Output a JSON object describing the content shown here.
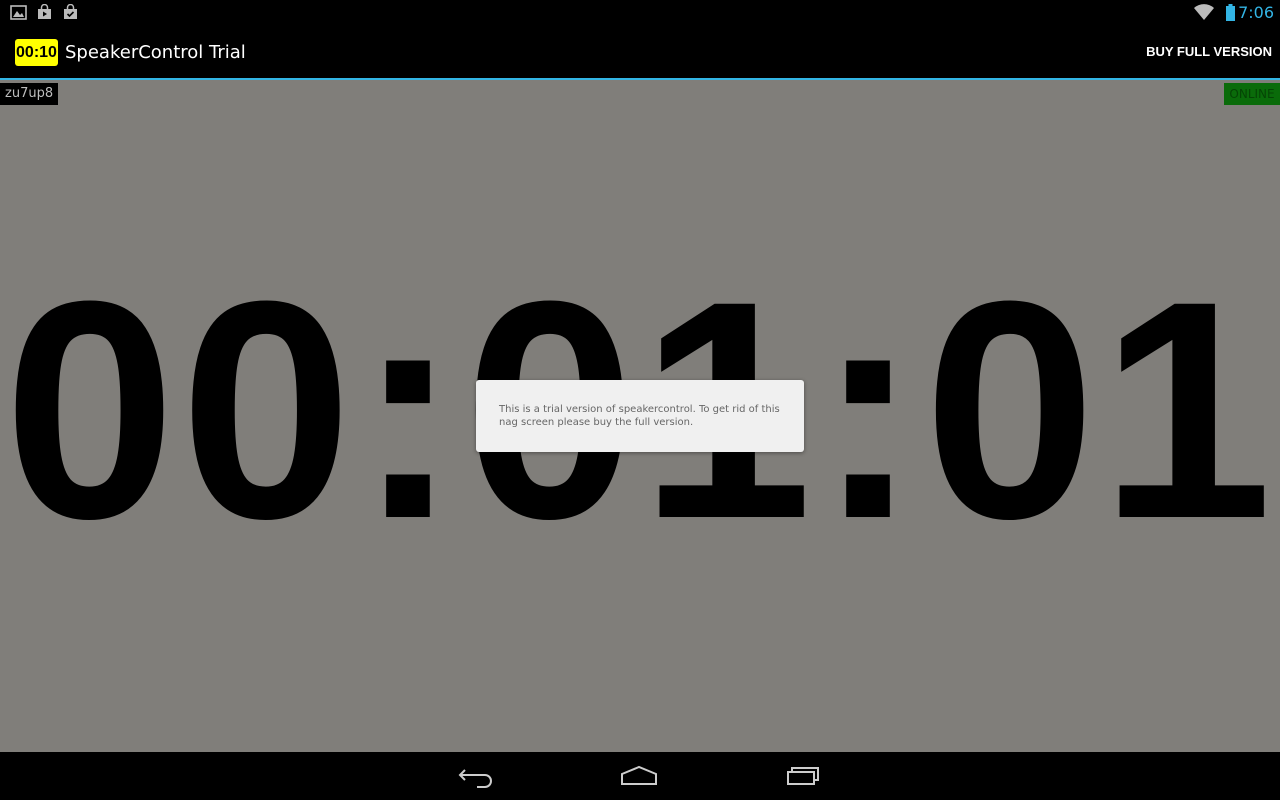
{
  "status_bar": {
    "time": "7:06",
    "notification_icons": [
      "image-icon",
      "play-store-icon",
      "shopping-bag-icon"
    ],
    "accent_color": "#33b5e5"
  },
  "action_bar": {
    "app_icon_text": "00:10",
    "app_icon_color": "#ffff00",
    "title": "SpeakerControl Trial",
    "buy_label": "BUY FULL VERSION"
  },
  "content": {
    "background": "#807e7a",
    "session_code": "zu7up8",
    "connection_status": "ONLINE",
    "timer": "00:01:01"
  },
  "dialog": {
    "message": "This is a trial version of speakercontrol. To get rid of this nag screen please buy the full version."
  },
  "nav_bar": {
    "buttons": [
      "back-icon",
      "home-icon",
      "recent-apps-icon"
    ]
  }
}
